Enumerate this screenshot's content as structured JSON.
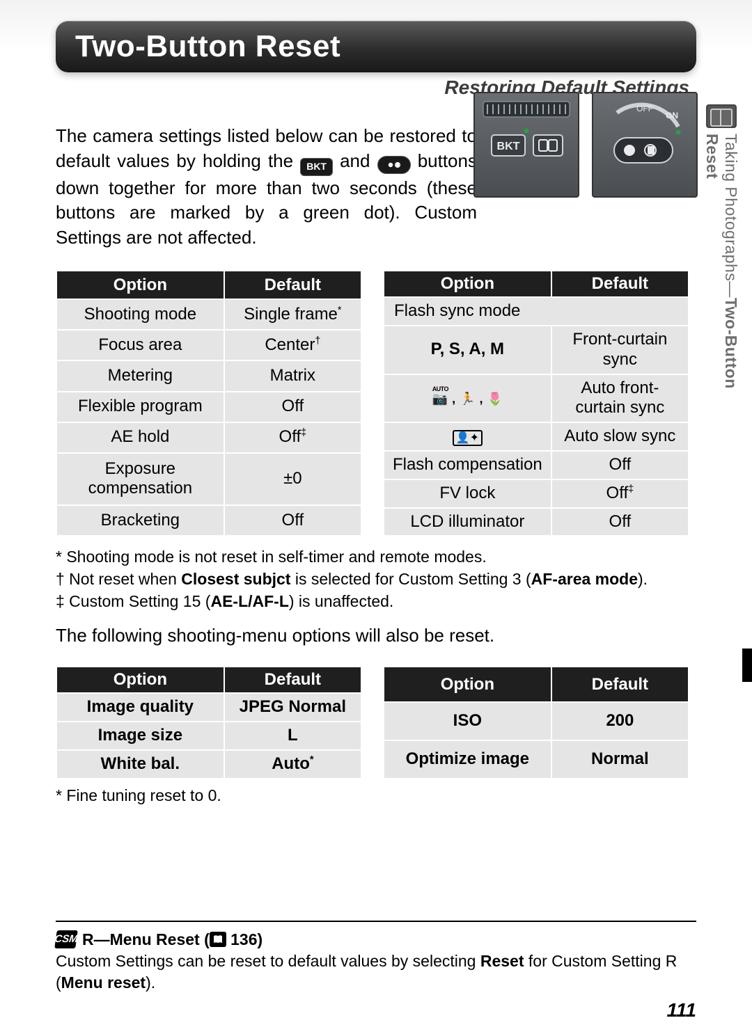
{
  "section_tab": {
    "prefix": "Taking Photographs—",
    "current": "Two-Button Reset"
  },
  "title": "Two-Button Reset",
  "subtitle": "Restoring Default Settings",
  "intro": {
    "part1": "The camera settings listed below can be restored to default values by holding the ",
    "icon1_label": "BKT",
    "part2": " and ",
    "icon2_label": "⦿",
    "part3": " buttons down together for more than two seconds (these buttons are marked by a green dot).  Custom Settings are not affected."
  },
  "table_headers": {
    "option": "Option",
    "default": "Default"
  },
  "table_left": [
    {
      "option": "Shooting mode",
      "default": "Single frame",
      "sup": "*"
    },
    {
      "option": "Focus area",
      "default": "Center",
      "sup": "†"
    },
    {
      "option": "Metering",
      "default": "Matrix",
      "sup": ""
    },
    {
      "option": "Flexible program",
      "default": "Off",
      "sup": ""
    },
    {
      "option": "AE hold",
      "default": "Off",
      "sup": "‡"
    },
    {
      "option": "Exposure compensation",
      "default": "±0",
      "sup": ""
    },
    {
      "option": "Bracketing",
      "default": "Off",
      "sup": ""
    }
  ],
  "table_right": {
    "subheader": "Flash sync mode",
    "rows": [
      {
        "option_is_modes": true,
        "option": "P, S, A, M",
        "default": "Front-curtain sync"
      },
      {
        "option_is_icons": true,
        "default": "Auto front-curtain sync"
      },
      {
        "option_is_night_icon": true,
        "default": "Auto slow sync"
      },
      {
        "option": "Flash compensation",
        "default": "Off"
      },
      {
        "option": "FV lock",
        "default": "Off",
        "sup": "‡"
      },
      {
        "option": "LCD illuminator",
        "default": "Off"
      }
    ]
  },
  "footnotes1": [
    {
      "mark": "*",
      "text": "Shooting mode is not reset in self-timer and remote modes."
    },
    {
      "mark": "†",
      "text_parts": [
        "Not reset when ",
        "Closest subjct",
        " is selected for Custom Setting 3 (",
        "AF-area mode",
        ")."
      ]
    },
    {
      "mark": "‡",
      "text_parts": [
        "Custom Setting 15 (",
        "AE-L/AF-L",
        ") is unaffected."
      ]
    }
  ],
  "midtext": "The following shooting-menu options will also be reset.",
  "table_bl": [
    {
      "option": "Image quality",
      "default": "JPEG Normal"
    },
    {
      "option": "Image size",
      "default": "L"
    },
    {
      "option": "White bal.",
      "default": "Auto",
      "sup": "*"
    }
  ],
  "table_br": [
    {
      "option": "ISO",
      "default": "200"
    },
    {
      "option": "Optimize image",
      "default": "Normal"
    }
  ],
  "footnotes2": [
    {
      "mark": "*",
      "text": "Fine tuning reset to 0."
    }
  ],
  "notebox": {
    "header_prefix": "R—Menu Reset (",
    "header_pageref": "136",
    "header_suffix": ")",
    "csm_label": "CSM",
    "body_parts": [
      "Custom Settings can be reset to default values by selecting ",
      "Reset",
      " for Custom Setting R (",
      "Menu reset",
      ")."
    ]
  },
  "page_number": "111"
}
